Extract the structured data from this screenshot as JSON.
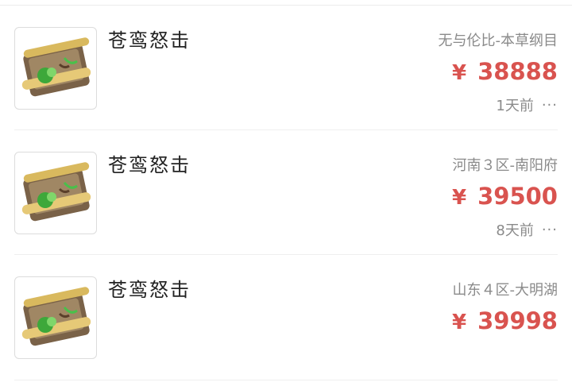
{
  "listings": [
    {
      "item_name": "苍鸾怒击",
      "server": "无与伦比-本草纲目",
      "currency": "¥",
      "price": "38888",
      "time_ago": "1天前",
      "more_icon": "ellipsis-icon"
    },
    {
      "item_name": "苍鸾怒击",
      "server": "河南３区-南阳府",
      "currency": "¥",
      "price": "39500",
      "time_ago": "8天前",
      "more_icon": "ellipsis-icon"
    },
    {
      "item_name": "苍鸾怒击",
      "server": "山东４区-大明湖",
      "currency": "¥",
      "price": "39998"
    }
  ],
  "colors": {
    "price": "#d9534f",
    "secondary_text": "#8a8a8a",
    "divider": "#efefef"
  }
}
